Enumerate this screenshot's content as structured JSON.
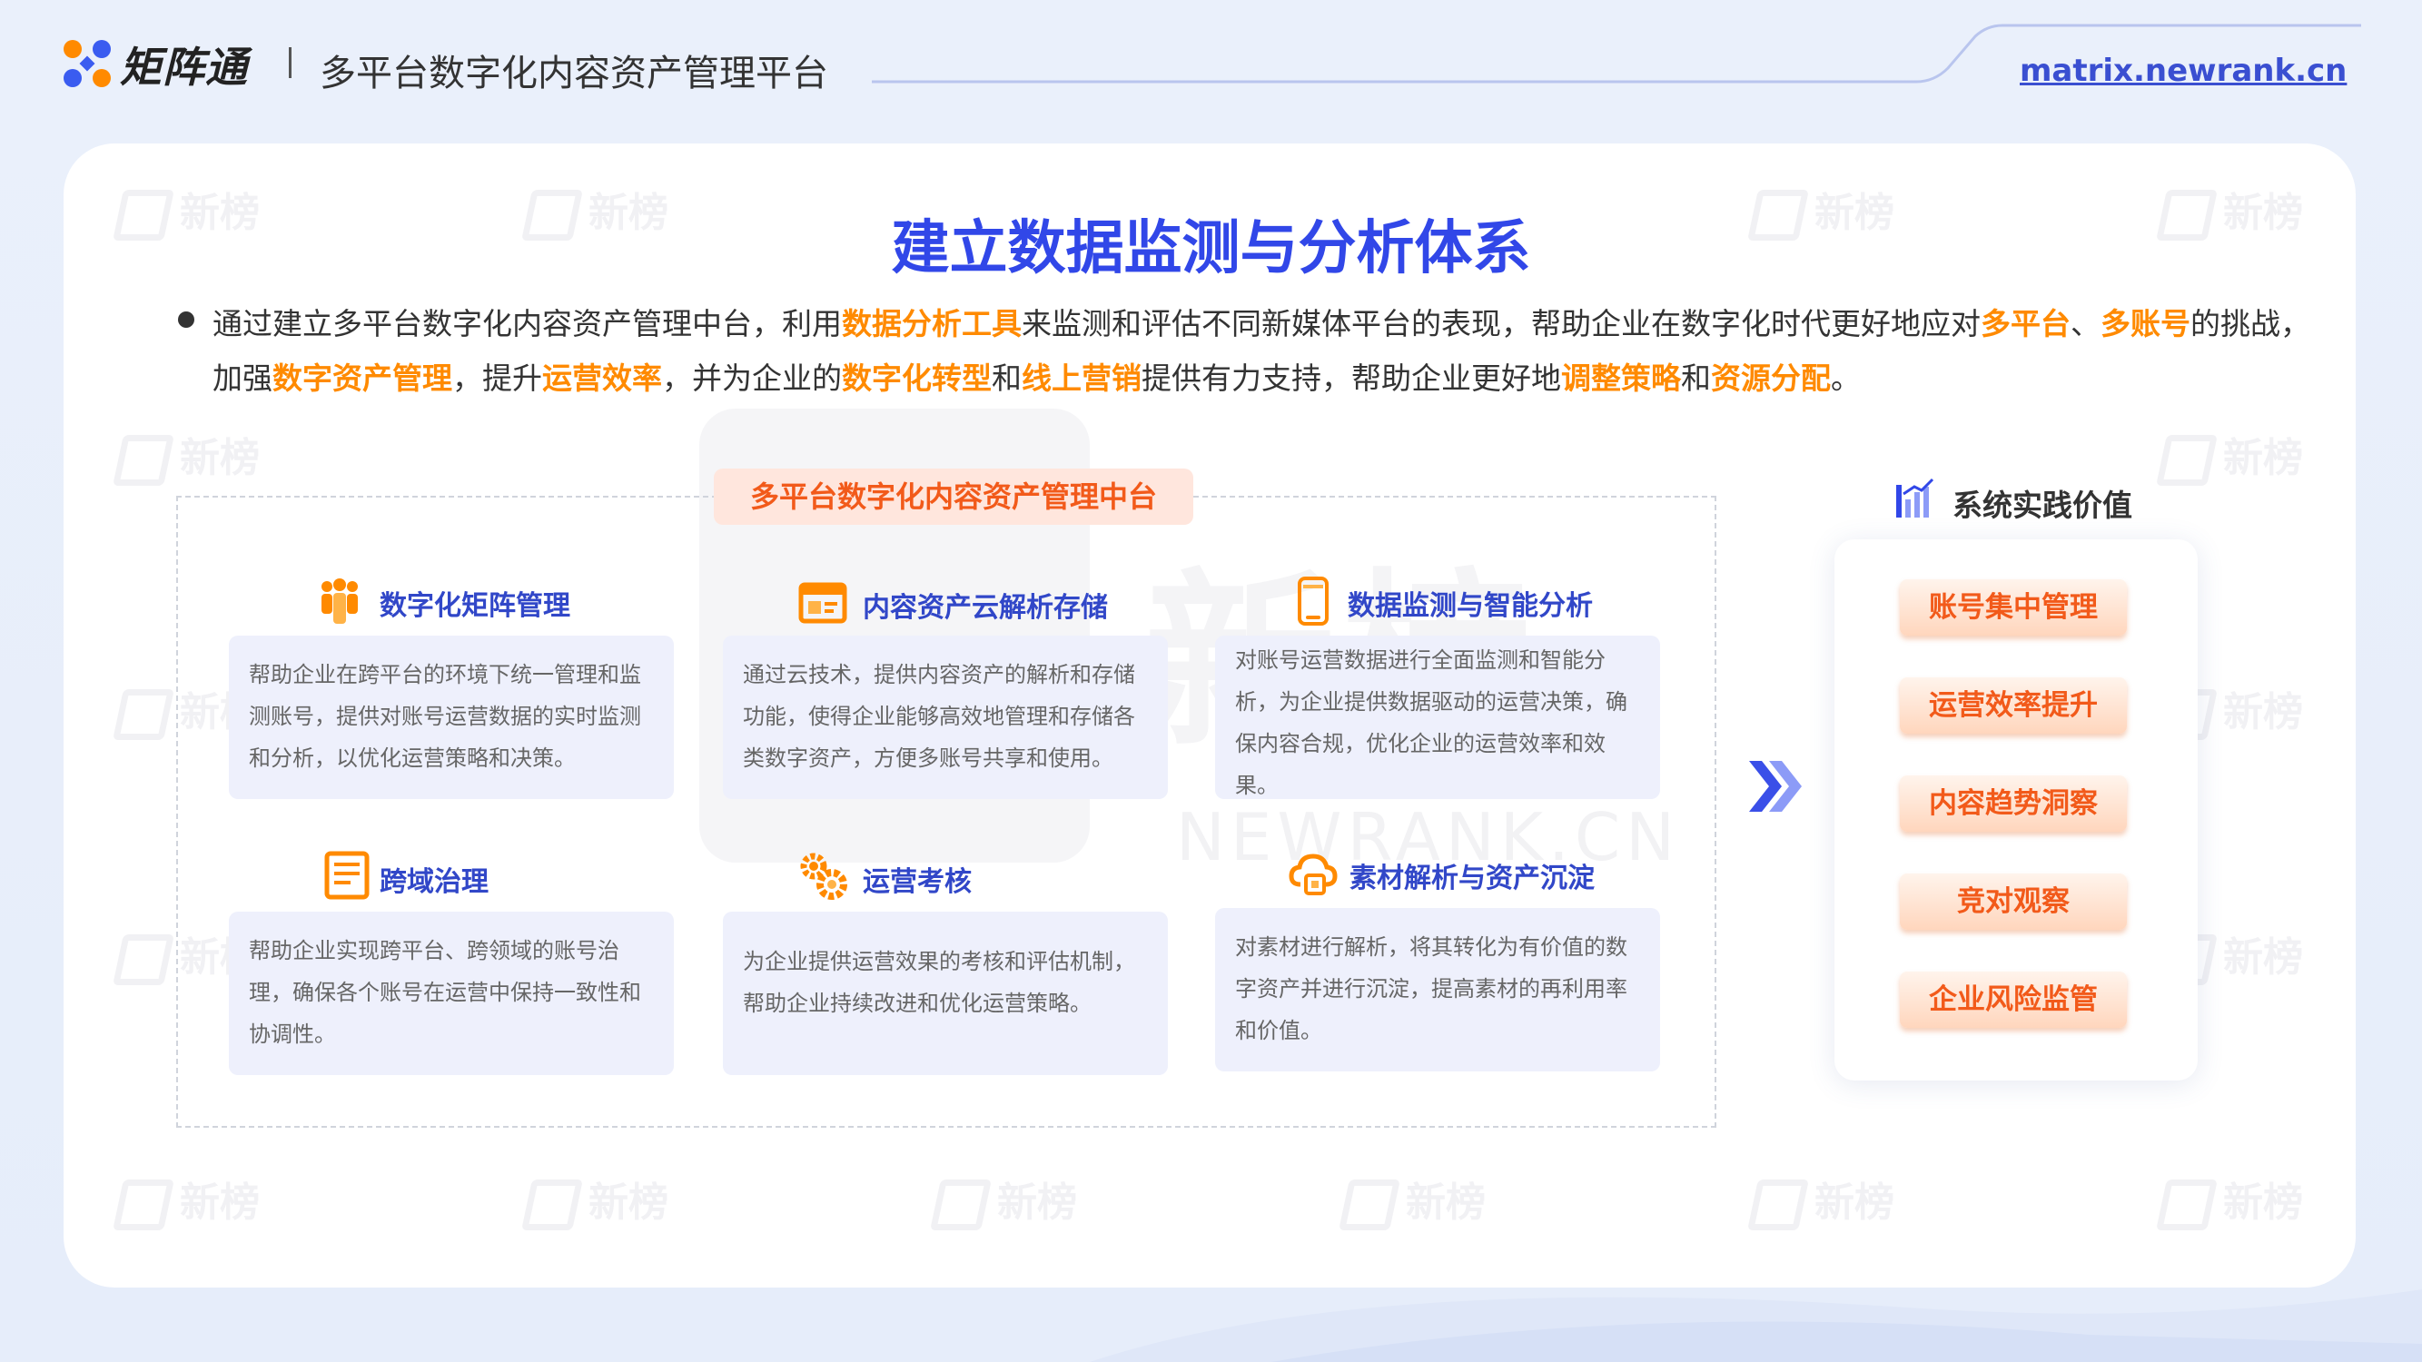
{
  "header": {
    "brand": "矩阵通",
    "subtitle": "多平台数字化内容资产管理平台",
    "url": "matrix.newrank.cn"
  },
  "watermark": {
    "text": "新榜",
    "big_text": "新榜",
    "big_en": "NEWRANK.CN"
  },
  "main_title": "建立数据监测与分析体系",
  "intro": {
    "line1": [
      {
        "t": "通过建立多平台数字化内容资产管理中台，利用",
        "h": false
      },
      {
        "t": "数据分析工具",
        "h": true
      },
      {
        "t": "来监测和评估不同新媒体平台的表现，帮助企业在数字化时代更好地应对",
        "h": false
      },
      {
        "t": "多平台",
        "h": true
      },
      {
        "t": "、",
        "h": false
      },
      {
        "t": "多账号",
        "h": true
      },
      {
        "t": "的挑战，",
        "h": false
      }
    ],
    "line2": [
      {
        "t": "加强",
        "h": false
      },
      {
        "t": "数字资产管理",
        "h": true
      },
      {
        "t": "，提升",
        "h": false
      },
      {
        "t": "运营效率",
        "h": true
      },
      {
        "t": "，并为企业的",
        "h": false
      },
      {
        "t": "数字化转型",
        "h": true
      },
      {
        "t": "和",
        "h": false
      },
      {
        "t": "线上营销",
        "h": true
      },
      {
        "t": "提供有力支持，帮助企业更好地",
        "h": false
      },
      {
        "t": "调整策略",
        "h": true
      },
      {
        "t": "和",
        "h": false
      },
      {
        "t": "资源分配",
        "h": true
      },
      {
        "t": "。",
        "h": false
      }
    ]
  },
  "platform": {
    "title": "多平台数字化内容资产管理中台",
    "features": [
      {
        "icon": "people-icon",
        "title": "数字化矩阵管理",
        "desc": "帮助企业在跨平台的环境下统一管理和监测账号，提供对账号运营数据的实时监测和分析，以优化运营策略和决策。"
      },
      {
        "icon": "browser-window-icon",
        "title": "内容资产云解析存储",
        "desc": "通过云技术，提供内容资产的解析和存储功能，使得企业能够高效地管理和存储各类数字资产，方便多账号共享和使用。"
      },
      {
        "icon": "mobile-phone-icon",
        "title": "数据监测与智能分析",
        "desc": "对账号运营数据进行全面监测和智能分析，为企业提供数据驱动的运营决策，确保内容合规，优化企业的运营效率和效果。"
      },
      {
        "icon": "document-icon",
        "title": "跨域治理",
        "desc": "帮助企业实现跨平台、跨领域的账号治理，确保各个账号在运营中保持一致性和协调性。"
      },
      {
        "icon": "gears-icon",
        "title": "运营考核",
        "desc": "为企业提供运营效果的考核和评估机制，帮助企业持续改进和优化运营策略。"
      },
      {
        "icon": "cloud-icon",
        "title": "素材解析与资产沉淀",
        "desc": "对素材进行解析，将其转化为有价值的数字资产并进行沉淀，提高素材的再利用率和价值。"
      }
    ]
  },
  "values": {
    "title": "系统实践价值",
    "items": [
      "账号集中管理",
      "运营效率提升",
      "内容趋势洞察",
      "竞对观察",
      "企业风险监管"
    ]
  },
  "colors": {
    "accent_blue": "#3147e8",
    "highlight_orange": "#ff8a00",
    "tag_orange": "#f25a1a"
  }
}
